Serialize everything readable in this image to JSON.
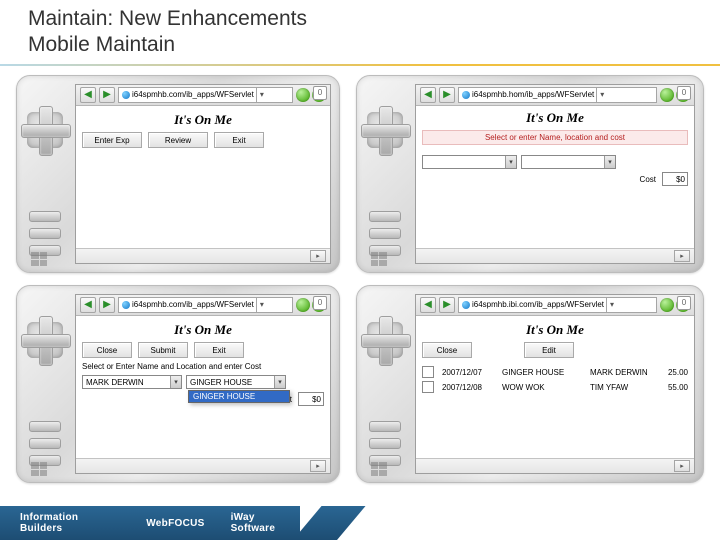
{
  "title_line1": "Maintain: New Enhancements",
  "title_line2": "Mobile Maintain",
  "footer": {
    "brand1": "Information Builders",
    "brand2": "WebFOCUS",
    "brand3": "iWay Software"
  },
  "devices": {
    "d1": {
      "url": "i64spmhb.com/ib_apps/WFServlet",
      "scroll": "0",
      "app_title": "It's On Me",
      "buttons": {
        "b1": "Enter Exp",
        "b2": "Review",
        "b3": "Exit"
      }
    },
    "d2": {
      "url": "i64spmhb.hom/ib_apps/WFServlet",
      "scroll": "0",
      "app_title": "It's On Me",
      "prompt": "Select or enter Name, location and cost",
      "cost_label": "Cost",
      "cost_value": "$0"
    },
    "d3": {
      "url": "i64spmhb.com/ib_apps/WFServlet",
      "scroll": "0",
      "app_title": "It's On Me",
      "buttons": {
        "b1": "Close",
        "b2": "Submit",
        "b3": "Exit"
      },
      "prompt": "Select or Enter Name and Location and enter Cost",
      "name_value": "MARK DERWIN",
      "loc_value": "GINGER HOUSE",
      "loc_popup_option": "GINGER HOUSE",
      "cost_label": "Cost",
      "cost_value": "$0"
    },
    "d4": {
      "url": "i64spmhb.ibi.com/ib_apps/WFServlet",
      "scroll": "0",
      "app_title": "It's On Me",
      "buttons": {
        "b1": "Close",
        "b2": "Edit"
      },
      "rows": [
        {
          "date": "2007/12/07",
          "loc": "GINGER HOUSE",
          "name": "MARK DERWIN",
          "amt": "25.00"
        },
        {
          "date": "2007/12/08",
          "loc": "WOW WOK",
          "name": "TIM YFAW",
          "amt": "55.00"
        }
      ]
    }
  }
}
